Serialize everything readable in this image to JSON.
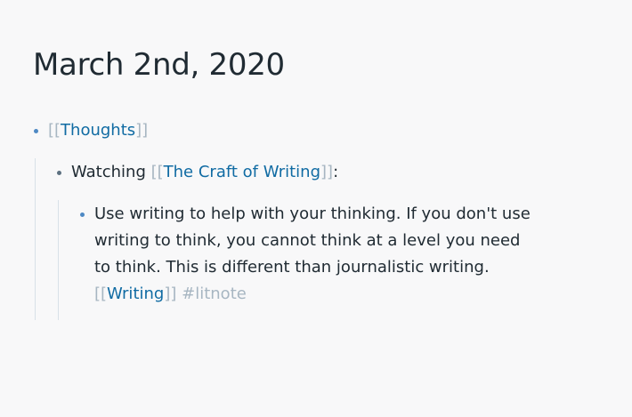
{
  "page": {
    "title": "March 2nd, 2020"
  },
  "blocks": [
    {
      "bracket_open": "[[",
      "link": "Thoughts",
      "bracket_close": "]]"
    },
    {
      "prefix": "Watching ",
      "bracket_open": "[[",
      "link": "The Craft of Writing",
      "bracket_close": "]]",
      "suffix": ":"
    },
    {
      "lines": [
        "Use writing to help with your thinking. If you don't use",
        "writing to think, you cannot think at a level you need",
        "to think. This is different than journalistic writing."
      ],
      "bracket_open": "[[",
      "link": "Writing",
      "bracket_close": "]]",
      "tag": "#litnote"
    }
  ],
  "colors": {
    "link": "#106ba3",
    "bracket": "#a7b6c2",
    "bullet": "#4e89c4",
    "background": "#f8f8f9"
  }
}
